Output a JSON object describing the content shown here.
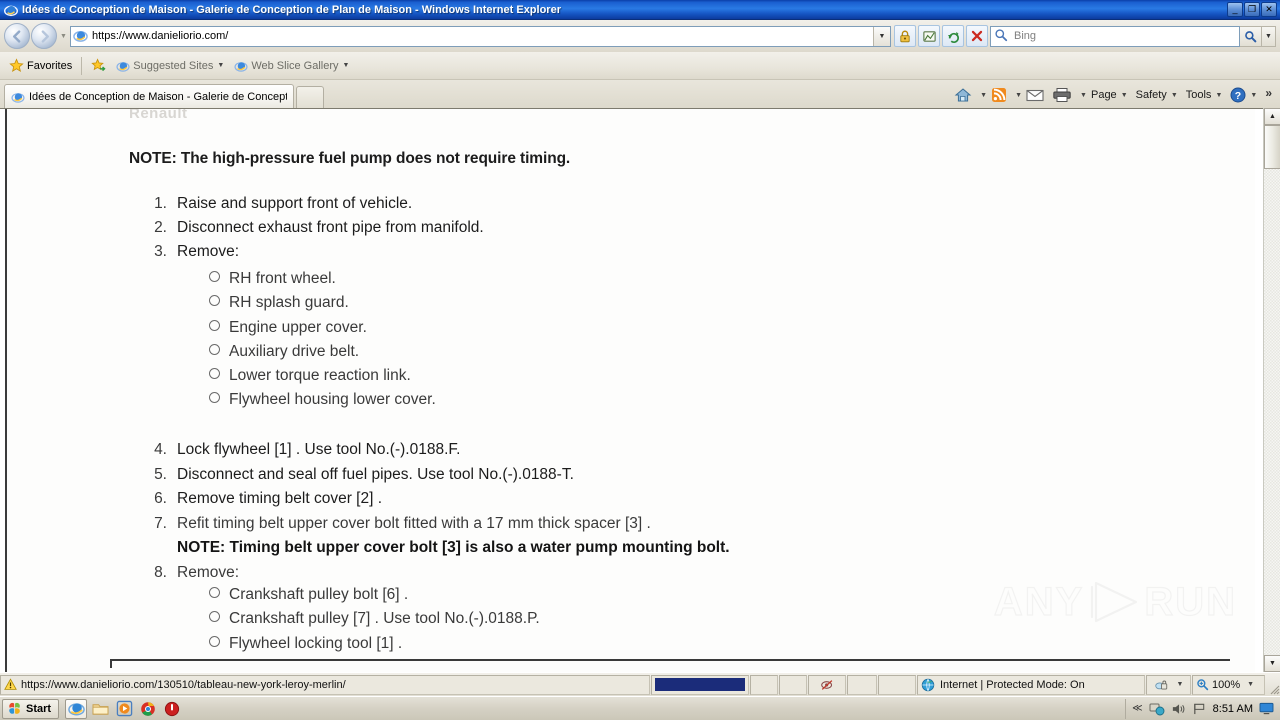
{
  "window": {
    "title": "Idées de Conception de Maison - Galerie de Conception de Plan de Maison - Windows Internet Explorer",
    "minimize_label": "_",
    "restore_label": "❐",
    "close_label": "✕"
  },
  "navbar": {
    "back_label": "◀",
    "forward_label": "▶",
    "history_caret": "▼",
    "address_value": "https://www.danieliorio.com/",
    "address_dropdown_caret": "▼",
    "buttons": [
      {
        "name": "lock-icon",
        "label": ""
      },
      {
        "name": "compatibility-view-icon",
        "label": ""
      },
      {
        "name": "refresh-icon",
        "label": ""
      },
      {
        "name": "stop-icon",
        "label": ""
      }
    ],
    "search_placeholder": "Bing",
    "search_go_label": "",
    "search_dropdown_caret": "▼"
  },
  "favorites_bar": {
    "favorites_label": "Favorites",
    "items": [
      {
        "label": "Suggested Sites",
        "caret": "▼"
      },
      {
        "label": "Web Slice Gallery",
        "caret": "▼"
      }
    ]
  },
  "tabs": {
    "items": [
      {
        "label": "Idées de Conception de Maison - Galerie de Conceptio..."
      }
    ],
    "new_tab_label": ""
  },
  "command_bar": {
    "items": [
      {
        "name": "home-icon",
        "label": "",
        "caret": "▼"
      },
      {
        "name": "feeds-icon",
        "label": "",
        "caret": "▼"
      },
      {
        "name": "mail-icon",
        "label": "",
        "caret": ""
      },
      {
        "name": "print-icon",
        "label": "",
        "caret": "▼"
      },
      {
        "name": "page-menu",
        "label": "Page",
        "caret": "▼"
      },
      {
        "name": "safety-menu",
        "label": "Safety",
        "caret": "▼"
      },
      {
        "name": "tools-menu",
        "label": "Tools",
        "caret": "▼"
      },
      {
        "name": "help-menu",
        "label": "",
        "caret": "▼"
      }
    ],
    "overflow_label": "»"
  },
  "document": {
    "ghost_top_text": "Renault",
    "note_heading": "NOTE: The high-pressure fuel pump does not require timing.",
    "steps": [
      {
        "num": "1.",
        "text": "Raise and support front of vehicle.",
        "bold": false,
        "subitems": []
      },
      {
        "num": "2.",
        "text": "Disconnect exhaust front pipe from manifold.",
        "bold": false,
        "subitems": []
      },
      {
        "num": "3.",
        "text": "Remove:",
        "bold": false,
        "subitems": [
          "RH front wheel.",
          "RH splash guard.",
          "Engine upper cover.",
          "Auxiliary drive belt.",
          "Lower torque reaction link.",
          "Flywheel housing lower cover."
        ]
      },
      {
        "num": "4.",
        "text": "Lock flywheel [1] . Use tool No.(-).0188.F.",
        "bold": false,
        "subitems": []
      },
      {
        "num": "5.",
        "text": "Disconnect and seal off fuel pipes. Use tool No.(-).0188-T.",
        "bold": false,
        "subitems": []
      },
      {
        "num": "6.",
        "text": "Remove timing belt cover [2] .",
        "bold": false,
        "subitems": []
      },
      {
        "num": "7.",
        "text": "Refit timing belt upper cover bolt fitted with a 17 mm thick spacer [3] .",
        "bold": false,
        "subitems": []
      },
      {
        "num": "",
        "text": "NOTE: Timing belt upper cover bolt [3] is also a water pump mounting bolt.",
        "bold": true,
        "subitems": []
      },
      {
        "num": "8.",
        "text": "Remove:",
        "bold": false,
        "subitems": [
          "Crankshaft pulley bolt [6] .",
          "Crankshaft pulley [7] . Use tool No.(-).0188.P.",
          "Flywheel locking tool [1] ."
        ]
      }
    ],
    "watermark": {
      "left": "ANY",
      "right": "RUN"
    }
  },
  "scrollbar": {
    "up_arrow": "▲",
    "down_arrow": "▼"
  },
  "status_bar": {
    "url": "https://www.danieliorio.com/130510/tableau-new-york-leroy-merlin/",
    "zone_text": "Internet | Protected Mode: On",
    "zoom_level": "100%",
    "zoom_caret": "▼",
    "privacy_caret": "▼"
  },
  "taskbar": {
    "start_label": "Start",
    "quick_launch": [
      {
        "name": "taskbar-ie-icon",
        "label": ""
      },
      {
        "name": "taskbar-explorer-icon",
        "label": ""
      },
      {
        "name": "taskbar-media-player-icon",
        "label": ""
      },
      {
        "name": "taskbar-chrome-icon",
        "label": ""
      },
      {
        "name": "taskbar-shutdown-icon",
        "label": ""
      }
    ],
    "tray": {
      "expand_caret": "≪",
      "clock": "8:51 AM"
    }
  },
  "colors": {
    "title_blue": "#1a5fd0",
    "chrome_beige": "#ddd9cd",
    "progress_blue": "#1b2c7a",
    "page_white": "#ffffff"
  }
}
